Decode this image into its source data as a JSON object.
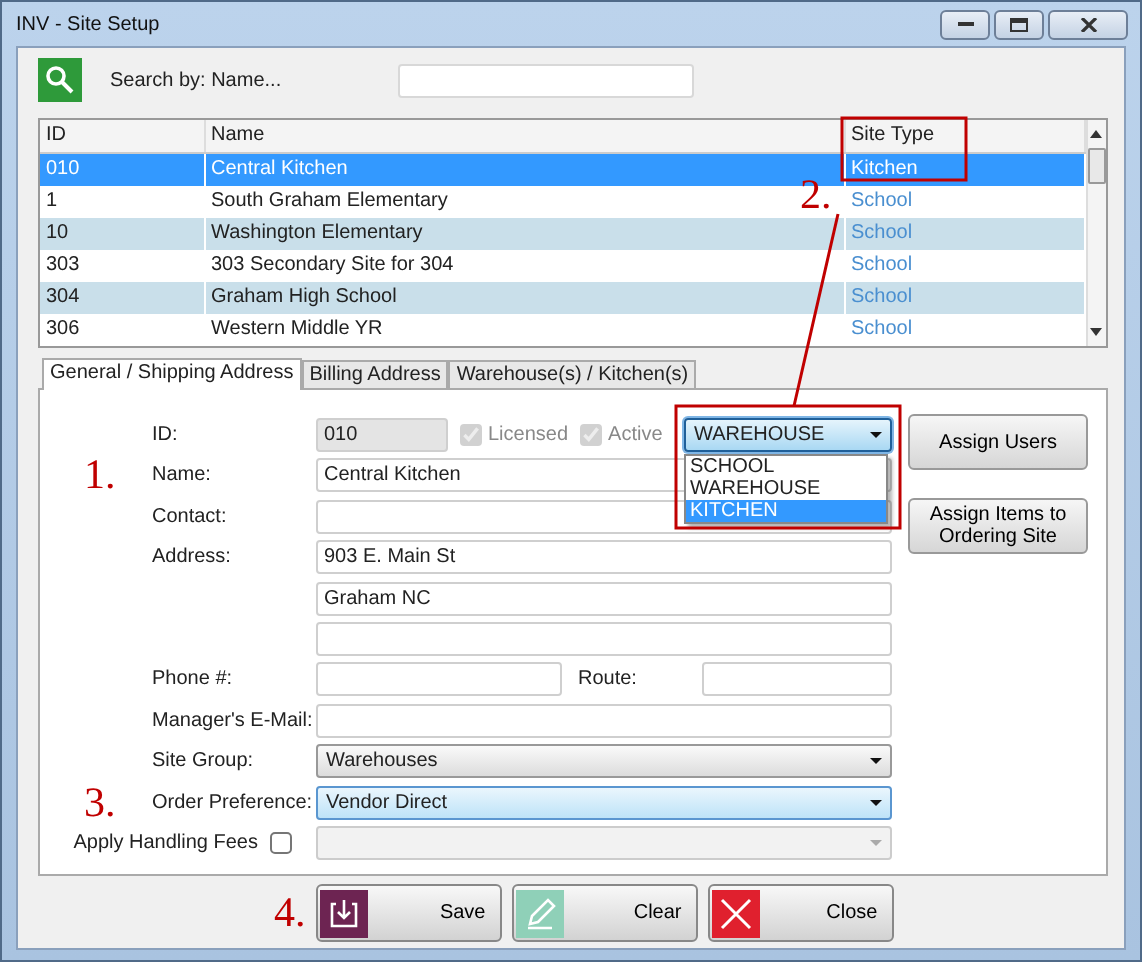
{
  "window": {
    "title": "INV - Site Setup"
  },
  "search": {
    "label": "Search by: Name..."
  },
  "table": {
    "columns": [
      "ID",
      "Name",
      "Site Type"
    ],
    "rows": [
      {
        "id": "010",
        "name": "Central Kitchen",
        "site_type": "Kitchen",
        "selected": true
      },
      {
        "id": "1",
        "name": "South Graham Elementary",
        "site_type": "School",
        "selected": false
      },
      {
        "id": "10",
        "name": "Washington Elementary",
        "site_type": "School",
        "selected": false
      },
      {
        "id": "303",
        "name": "303 Secondary Site for 304",
        "site_type": "School",
        "selected": false
      },
      {
        "id": "304",
        "name": "Graham High School",
        "site_type": "School",
        "selected": false
      },
      {
        "id": "306",
        "name": "Western Middle YR",
        "site_type": "School",
        "selected": false
      }
    ]
  },
  "tabs": [
    {
      "label": "General / Shipping Address",
      "selected": true
    },
    {
      "label": "Billing Address",
      "selected": false
    },
    {
      "label": "Warehouse(s) / Kitchen(s)",
      "selected": false
    }
  ],
  "form": {
    "id": {
      "label": "ID:",
      "value": "010"
    },
    "licensed": {
      "label": "Licensed",
      "checked": true,
      "disabled": true
    },
    "active": {
      "label": "Active",
      "checked": true,
      "disabled": true
    },
    "site_type": {
      "value": "WAREHOUSE",
      "expanded": true,
      "options": [
        {
          "label": "SCHOOL",
          "highlighted": false
        },
        {
          "label": "WAREHOUSE",
          "highlighted": false
        },
        {
          "label": "KITCHEN",
          "highlighted": true
        }
      ]
    },
    "rows": [
      {
        "kind": "text",
        "label": "Name:",
        "value": "Central Kitchen",
        "callout": "1."
      },
      {
        "kind": "text",
        "label": "Contact:"
      },
      {
        "kind": "text",
        "label": "Address:",
        "value": "903 E. Main St"
      },
      {
        "kind": "text",
        "value": "Graham NC"
      },
      {
        "kind": "text"
      },
      {
        "kind": "pair",
        "label": "Phone #:",
        "label_2": "Route:"
      },
      {
        "kind": "text",
        "label": "Manager's E-Mail:"
      },
      {
        "kind": "select",
        "label": "Site Group:",
        "value": "Warehouses",
        "focused": false
      },
      {
        "kind": "select",
        "label": "Order Preference:",
        "value": "Vendor Direct",
        "focused": true,
        "callout": "3."
      },
      {
        "kind": "check_select",
        "label": "Apply Handling Fees",
        "checked": false,
        "disabled": true
      }
    ]
  },
  "side_buttons": [
    "Assign Users",
    "Assign Items to Ordering Site"
  ],
  "buttons": [
    {
      "kind": "save",
      "label": "Save"
    },
    {
      "kind": "clear",
      "label": "Clear"
    },
    {
      "kind": "close",
      "label": "Close"
    }
  ],
  "buttons_callout": "4.",
  "site_type_callout": "2."
}
